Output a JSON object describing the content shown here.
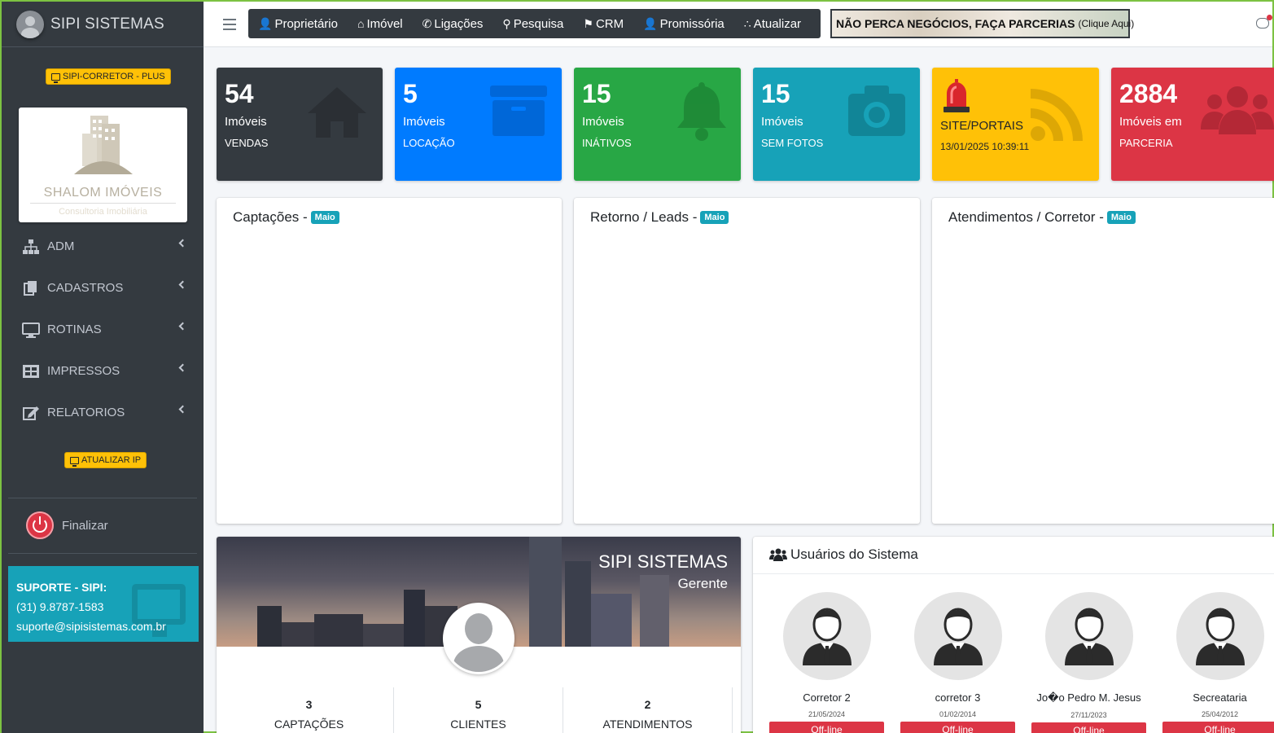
{
  "brand": {
    "name": "SIPI SISTEMAS"
  },
  "sidebar": {
    "plan_badge": "SIPI-CORRETOR - PLUS",
    "logo": {
      "name": "SHALOM IMÓVEIS",
      "sub": "Consultoria Imobiliária"
    },
    "items": [
      {
        "label": "ADM",
        "icon": "sitemap-icon"
      },
      {
        "label": "CADASTROS",
        "icon": "copy-icon"
      },
      {
        "label": "ROTINAS",
        "icon": "desktop-icon"
      },
      {
        "label": "IMPRESSOS",
        "icon": "table-icon"
      },
      {
        "label": "RELATORIOS",
        "icon": "edit-icon"
      }
    ],
    "ip_badge": "ATUALIZAR IP",
    "logout": "Finalizar",
    "support": {
      "title": "SUPORTE - SIPI:",
      "phone": "(31) 9.8787-1583",
      "email": "suporte@sipisistemas.com.br"
    }
  },
  "topbar": {
    "menu": [
      {
        "label": "Proprietário",
        "icon": "user-icon"
      },
      {
        "label": "Imóvel",
        "icon": "home-icon"
      },
      {
        "label": "Ligações",
        "icon": "phone-icon"
      },
      {
        "label": "Pesquisa",
        "icon": "search-icon"
      },
      {
        "label": "CRM",
        "icon": "bell-icon"
      },
      {
        "label": "Promissória",
        "icon": "user-icon"
      },
      {
        "label": "Atualizar",
        "icon": "rss-icon"
      }
    ],
    "banner": {
      "text": "NÃO PERCA NEGÓCIOS, FAÇA PARCERIAS",
      "hint": "(Clique Aqui)"
    }
  },
  "stats": [
    {
      "num": "54",
      "l1": "Imóveis",
      "l2": "VENDAS",
      "color": "#343a40",
      "icon": "home-icon"
    },
    {
      "num": "5",
      "l1": "Imóveis",
      "l2": "LOCAÇÃO",
      "color": "#007bff",
      "icon": "archive-icon"
    },
    {
      "num": "15",
      "l1": "Imóveis",
      "l2": "INÁTIVOS",
      "color": "#28a745",
      "icon": "bell-icon"
    },
    {
      "num": "15",
      "l1": "Imóveis",
      "l2": "SEM FOTOS",
      "color": "#17a2b8",
      "icon": "camera-icon"
    },
    {
      "num": "",
      "l1": "SITE/PORTAIS",
      "l2": "13/01/2025 10:39:11",
      "color": "#ffc107",
      "icon": "rss-icon"
    },
    {
      "num": "2884",
      "l1": "Imóveis em",
      "l2": "PARCERIA",
      "color": "#dc3545",
      "icon": "users-icon"
    }
  ],
  "charts": [
    {
      "title": "Captações -",
      "month": "Maio"
    },
    {
      "title": "Retorno / Leads -",
      "month": "Maio"
    },
    {
      "title": "Atendimentos / Corretor -",
      "month": "Maio"
    }
  ],
  "profile": {
    "name": "SIPI SISTEMAS",
    "role": "Gerente",
    "stats": [
      {
        "value": "3",
        "label": "CAPTAÇÕES"
      },
      {
        "value": "5",
        "label": "CLIENTES"
      },
      {
        "value": "2",
        "label": "ATENDIMENTOS"
      }
    ]
  },
  "users": {
    "title": "Usuários do Sistema",
    "list": [
      {
        "name": "Corretor 2",
        "date": "21/05/2024",
        "status": "Off-line"
      },
      {
        "name": "corretor 3",
        "date": "01/02/2014",
        "status": "Off-line"
      },
      {
        "name": "Jo�o Pedro M. Jesus",
        "date": "27/11/2023",
        "status": "Off-line"
      },
      {
        "name": "Secreataria",
        "date": "25/04/2012",
        "status": "Off-line"
      }
    ]
  }
}
